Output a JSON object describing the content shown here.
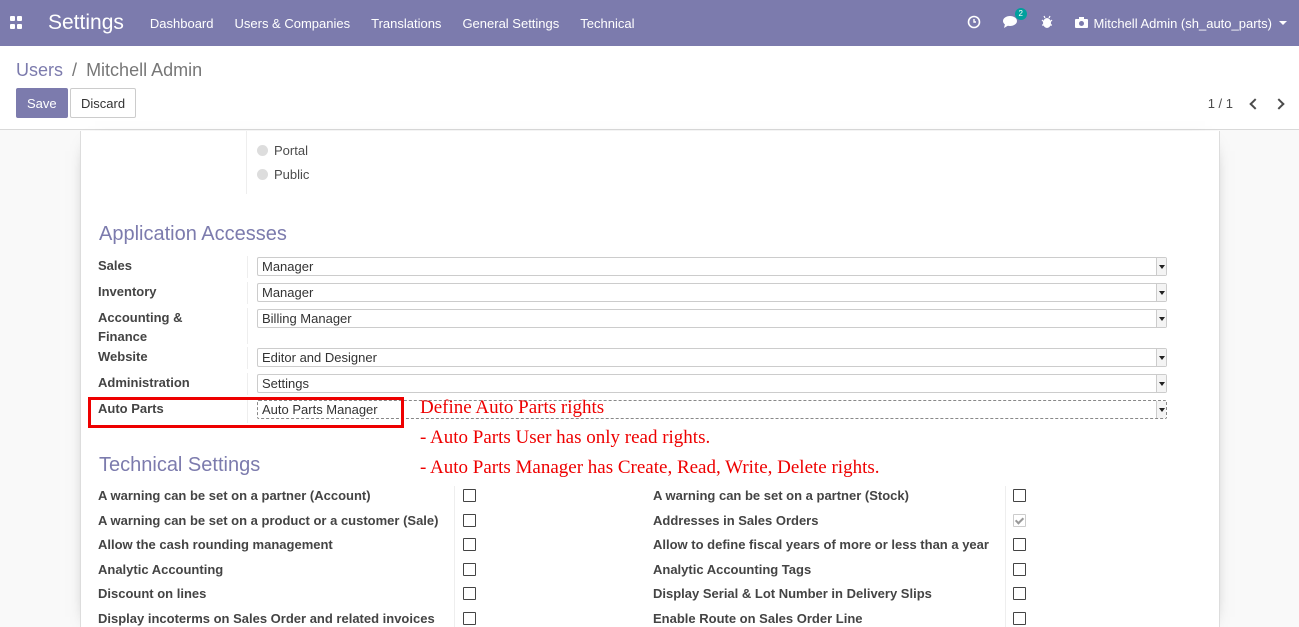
{
  "navbar": {
    "apps_icon": "apps-grid-icon",
    "brand": "Settings",
    "menu": [
      "Dashboard",
      "Users & Companies",
      "Translations",
      "General Settings",
      "Technical"
    ],
    "activity_icon": "clock-icon",
    "messages_icon": "chat-icon",
    "messages_badge": "2",
    "debug_icon": "bug-icon",
    "user_icon": "camera-icon",
    "user_name": "Mitchell Admin (sh_auto_parts)"
  },
  "breadcrumb": {
    "parent": "Users",
    "separator": "/",
    "current": "Mitchell Admin"
  },
  "toolbar": {
    "save_label": "Save",
    "discard_label": "Discard"
  },
  "pager": {
    "value": "1 / 1"
  },
  "user_type": {
    "options": [
      "Portal",
      "Public"
    ]
  },
  "app_access": {
    "title": "Application Accesses",
    "fields": [
      {
        "label": "Sales",
        "value": "Manager"
      },
      {
        "label": "Inventory",
        "value": "Manager"
      },
      {
        "label": "Accounting & Finance",
        "value": "Billing Manager"
      },
      {
        "label": "Website",
        "value": "Editor and Designer"
      },
      {
        "label": "Administration",
        "value": "Settings"
      },
      {
        "label": "Auto Parts",
        "value": "Auto Parts Manager"
      }
    ]
  },
  "annotation": {
    "line1": "Define Auto Parts rights",
    "line2": "- Auto Parts User has only read rights.",
    "line3": "- Auto Parts Manager has Create, Read, Write, Delete rights."
  },
  "technical": {
    "title": "Technical Settings",
    "left": [
      {
        "label": "A warning can be set on a partner (Account)",
        "checked": false
      },
      {
        "label": "A warning can be set on a product or a customer (Sale)",
        "checked": false
      },
      {
        "label": "Allow the cash rounding management",
        "checked": false
      },
      {
        "label": "Analytic Accounting",
        "checked": false
      },
      {
        "label": "Discount on lines",
        "checked": false
      },
      {
        "label": "Display incoterms on Sales Order and related invoices",
        "checked": false
      }
    ],
    "right": [
      {
        "label": "A warning can be set on a partner (Stock)",
        "checked": false
      },
      {
        "label": "Addresses in Sales Orders",
        "checked": true
      },
      {
        "label": "Allow to define fiscal years of more or less than a year",
        "checked": false
      },
      {
        "label": "Analytic Accounting Tags",
        "checked": false
      },
      {
        "label": "Display Serial & Lot Number in Delivery Slips",
        "checked": false
      },
      {
        "label": "Enable Route on Sales Order Line",
        "checked": false
      }
    ]
  }
}
